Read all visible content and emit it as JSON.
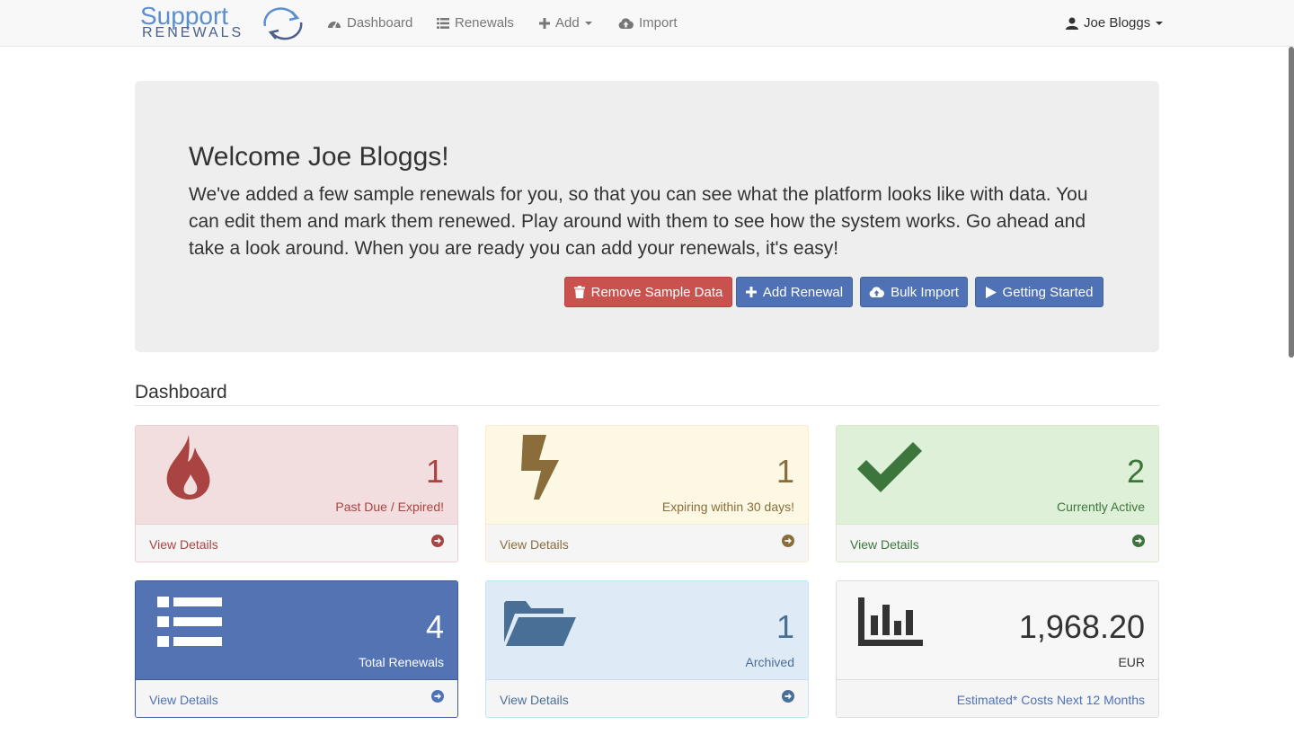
{
  "nav": {
    "logo_top": "Support",
    "logo_bottom": "RENEWALS",
    "items": [
      {
        "label": "Dashboard",
        "icon": "dashboard-icon"
      },
      {
        "label": "Renewals",
        "icon": "list-icon"
      },
      {
        "label": "Add",
        "icon": "plus-icon"
      },
      {
        "label": "Import",
        "icon": "cloud-upload-icon"
      }
    ],
    "user": "Joe Bloggs"
  },
  "welcome": {
    "title": "Welcome Joe Bloggs!",
    "text": "We've added a few sample renewals for you, so that you can see what the platform looks like with data. You can edit them and mark them renewed. Play around with them to see how the system works. Go ahead and take a look around. When you are ready you can add your renewals, it's easy!",
    "buttons": {
      "remove": "Remove Sample Data",
      "add": "Add Renewal",
      "bulk": "Bulk Import",
      "started": "Getting Started"
    }
  },
  "dashboard": {
    "title": "Dashboard",
    "view_details": "View Details",
    "panels": {
      "expired": {
        "value": "1",
        "label": "Past Due / Expired!"
      },
      "expiring": {
        "value": "1",
        "label": "Expiring within 30 days!"
      },
      "active": {
        "value": "2",
        "label": "Currently Active"
      },
      "total": {
        "value": "4",
        "label": "Total Renewals"
      },
      "archived": {
        "value": "1",
        "label": "Archived"
      },
      "costs": {
        "value": "1,968.20",
        "currency": "EUR",
        "footer": "Estimated* Costs Next 12 Months"
      }
    }
  },
  "colors": {
    "primary": "#4f71b6",
    "danger": "#c9524f",
    "success": "#3c763d",
    "warning": "#8a6d3b"
  }
}
